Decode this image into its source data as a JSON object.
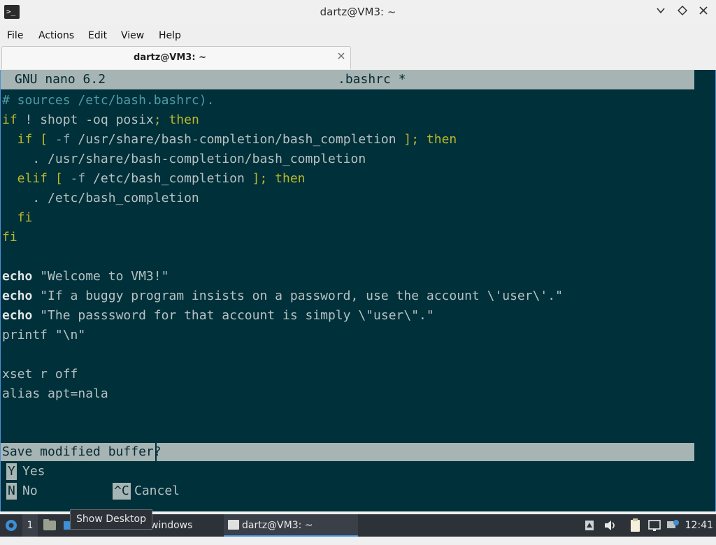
{
  "window": {
    "title": "dartz@VM3: ~",
    "app_icon": "terminal-icon",
    "controls": {
      "minimize": "chevron-down-icon",
      "maximize": "diamond-icon",
      "close": "close-icon"
    }
  },
  "menu": [
    "File",
    "Actions",
    "Edit",
    "View",
    "Help"
  ],
  "tabs": [
    {
      "label": "dartz@VM3: ~",
      "close_icon": "close-icon"
    }
  ],
  "nano": {
    "version": "GNU nano 6.2",
    "filename": ".bashrc *",
    "lines": {
      "l0": "# sources /etc/bash.bashrc).",
      "l1_if": "if",
      "l1_mid": " ! shopt -oq posix",
      "l1_then": "; then",
      "l2_if": "  if",
      "l2_open": " [ ",
      "l2_f": "-f",
      "l2_path": " /usr/share/bash-completion/bash_completion ",
      "l2_close": "]; then",
      "l3": "    . /usr/share/bash-completion/bash_completion",
      "l4_elif": "  elif",
      "l4_open": " [ ",
      "l4_f": "-f",
      "l4_path": " /etc/bash_completion ",
      "l4_close": "]; then",
      "l5": "    . /etc/bash_completion",
      "l6": "  fi",
      "l7": "fi",
      "l9_cmd": "echo",
      "l9_arg": " \"Welcome to VM3!\"",
      "l10_cmd": "echo",
      "l10_arg": " \"If a buggy program insists on a password, use the account \\'user\\'.\"",
      "l11_cmd": "echo",
      "l11_arg": " \"The passsword for that account is simply \\\"user\\\".\"",
      "l12": "printf \"\\n\"",
      "l14": "xset r off",
      "l15": "alias apt=nala"
    },
    "prompt": "Save modified buffer?",
    "options": [
      {
        "key": "Y",
        "label": "Yes"
      },
      {
        "key": "N",
        "label": "No"
      },
      {
        "key": "^C",
        "label": "Cancel"
      }
    ]
  },
  "taskbar": {
    "start_icon": "start-menu-icon",
    "workspace": "1",
    "tooltip": "Show Desktop",
    "windows_label": "windows",
    "task_label": "dartz@VM3: ~",
    "clock": "12:41"
  }
}
